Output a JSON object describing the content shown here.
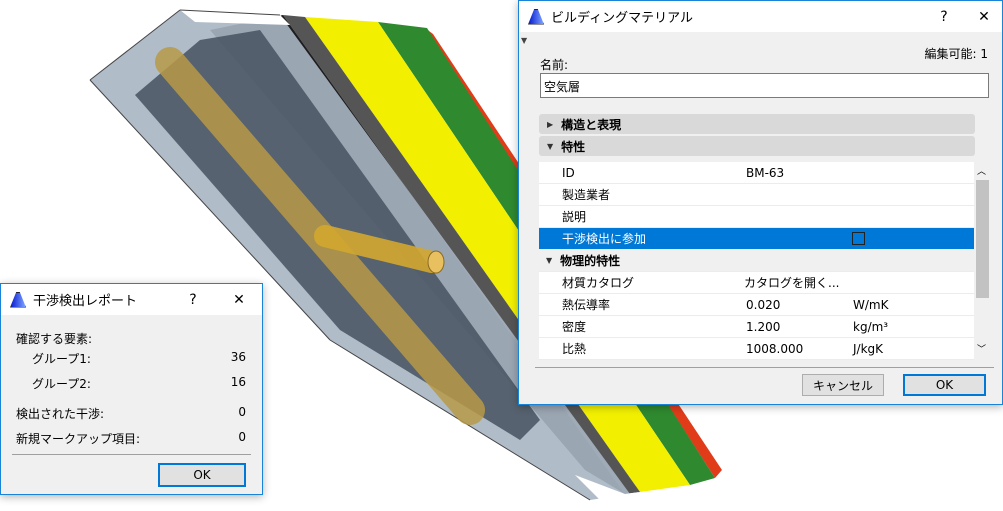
{
  "scene": {
    "colors": {
      "glass": "#a9b5c3",
      "black": "#1e1e1e",
      "gray": "#555555",
      "yellow": "#f2f000",
      "green": "#2f8a2f",
      "red": "#e03c1a",
      "pipe": "#c8a850"
    }
  },
  "material_dialog": {
    "title": "ビルディングマテリアル",
    "help": "?",
    "close": "✕",
    "editable": "編集可能: 1",
    "name_label": "名前:",
    "name_value": "空気層",
    "section_structure": "構造と表現",
    "section_properties": "特性",
    "rows": [
      {
        "label": "ID",
        "value": "BM-63"
      },
      {
        "label": "製造業者",
        "value": ""
      },
      {
        "label": "説明",
        "value": ""
      },
      {
        "label": "干渉検出に参加",
        "checked": false
      }
    ],
    "sub_section_physical": "物理的特性",
    "physical_rows": [
      {
        "label": "材質カタログ",
        "value": "カタログを開く...",
        "unit": ""
      },
      {
        "label": "熱伝導率",
        "value": "0.020",
        "unit": "W/mK"
      },
      {
        "label": "密度",
        "value": "1.200",
        "unit": "kg/m³"
      },
      {
        "label": "比熱",
        "value": "1008.000",
        "unit": "J/kgK"
      }
    ],
    "cancel": "キャンセル",
    "ok": "OK"
  },
  "report_dialog": {
    "title": "干渉検出レポート",
    "help": "?",
    "close": "✕",
    "elements_label": "確認する要素:",
    "group1_label": "グループ1:",
    "group1_value": "36",
    "group2_label": "グループ2:",
    "group2_value": "16",
    "detected_label": "検出された干渉:",
    "detected_value": "0",
    "markup_label": "新規マークアップ項目:",
    "markup_value": "0",
    "ok": "OK"
  }
}
